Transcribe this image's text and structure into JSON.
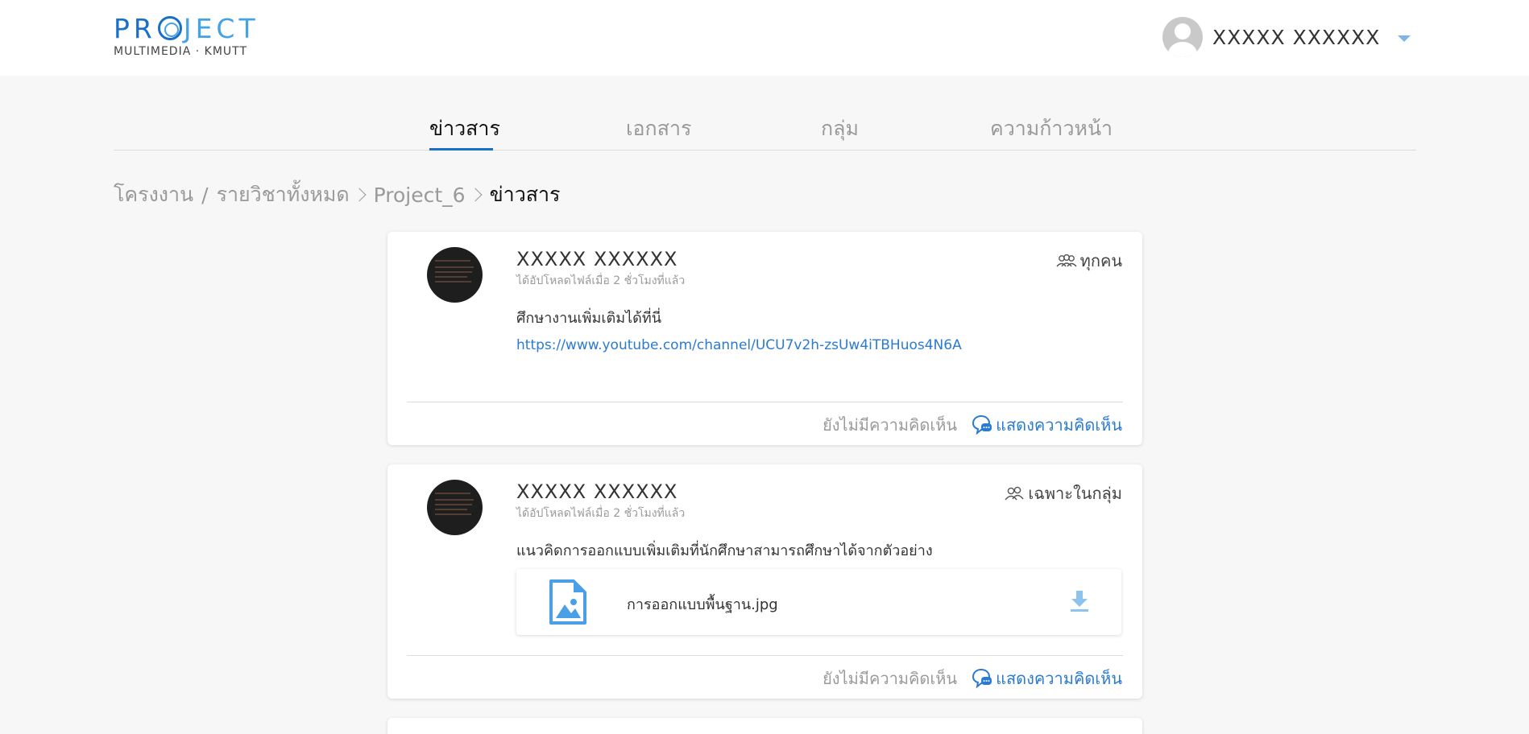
{
  "logo": {
    "main_p": "P",
    "main_r": "R",
    "main_rest": "JECT",
    "sub": "MULTIMEDIA · KMUTT"
  },
  "user": {
    "name": "XXXXX XXXXXX"
  },
  "tabs": [
    {
      "label": "ข่าวสาร",
      "active": true
    },
    {
      "label": "เอกสาร",
      "active": false
    },
    {
      "label": "กลุ่ม",
      "active": false
    },
    {
      "label": "ความก้าวหน้า",
      "active": false
    }
  ],
  "breadcrumb": {
    "projects": "โครงงาน",
    "slash": "/",
    "all_courses": "รายวิชาทั้งหมด",
    "project": "Project_6",
    "current": "ข่าวสาร"
  },
  "posts": [
    {
      "author": "XXXXX XXXXXX",
      "meta": "ได้อัปโหลดไฟล์เมื่อ 2 ชั่วโมงที่แล้ว",
      "audience": "ทุกคน",
      "text": "ศึกษางานเพิ่มเติมได้ที่นี่",
      "link": "https://www.youtube.com/channel/UCU7v2h-zsUw4iTBHuos4N6A",
      "no_comments": "ยังไม่มีความคิดเห็น",
      "show_comments": "แสดงความคิดเห็น"
    },
    {
      "author": "XXXXX XXXXXX",
      "meta": "ได้อัปโหลดไฟล์เมื่อ 2 ชั่วโมงที่แล้ว",
      "audience": "เฉพาะในกลุ่ม",
      "text": "แนวคิดการออกแบบเพิ่มเติมที่นักศึกษาสามารถศึกษาได้จากตัวอย่าง",
      "attachment": {
        "name": "การออกแบบพื้นฐาน.jpg",
        "icon": "image-file-icon"
      },
      "no_comments": "ยังไม่มีความคิดเห็น",
      "show_comments": "แสดงความคิดเห็น"
    }
  ],
  "colors": {
    "accent": "#1a6fc9",
    "link": "#2a7bd1",
    "muted": "#9a9a9a",
    "background": "#f7f7f7"
  }
}
